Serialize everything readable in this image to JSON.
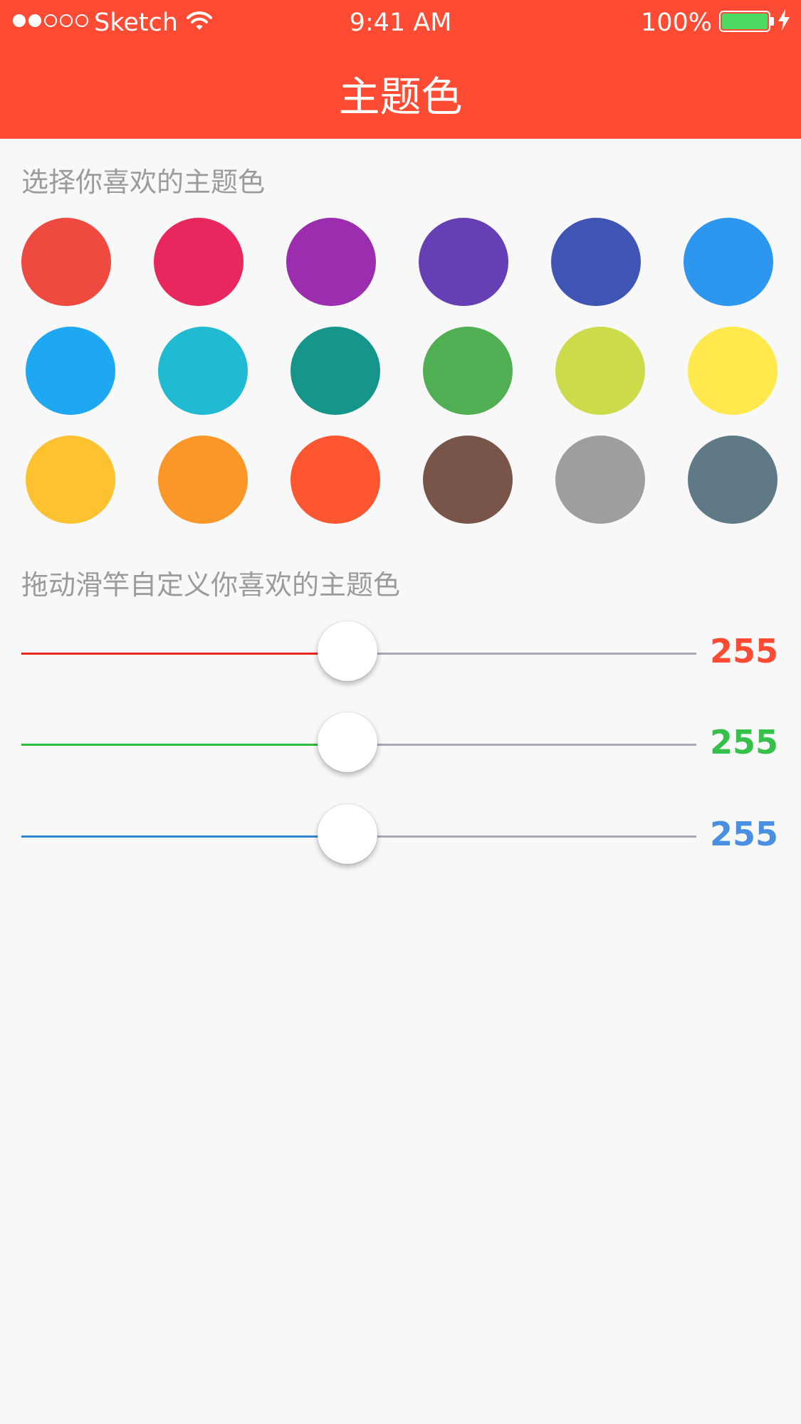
{
  "status_bar": {
    "carrier": "Sketch",
    "time": "9:41 AM",
    "battery": "100%",
    "signal_icon": "signal-dots-icon",
    "wifi_icon": "wifi-icon",
    "battery_icon": "battery-icon",
    "charging_icon": "bolt-icon"
  },
  "header": {
    "title": "主题色",
    "background": "#ff4b33"
  },
  "palette_section": {
    "label": "选择你喜欢的主题色",
    "colors": [
      "#ef4a3f",
      "#e8275f",
      "#9c2daf",
      "#673fb4",
      "#3f54b3",
      "#2d96ef",
      "#1ea8f1",
      "#20bad3",
      "#16968a",
      "#4faf52",
      "#ccdb4a",
      "#ffe94d",
      "#fec12f",
      "#fb9729",
      "#fd5631",
      "#795549",
      "#9e9e9e",
      "#607987"
    ]
  },
  "custom_section": {
    "label": "拖动滑竿自定义你喜欢的主题色",
    "sliders": [
      {
        "channel": "red",
        "value": "255",
        "color": "#ff4b33",
        "track_color": "#e8271c"
      },
      {
        "channel": "green",
        "value": "255",
        "color": "#35c14a",
        "track_color": "#2ebc3f"
      },
      {
        "channel": "blue",
        "value": "255",
        "color": "#4a90e2",
        "track_color": "#2e86d8"
      }
    ]
  }
}
